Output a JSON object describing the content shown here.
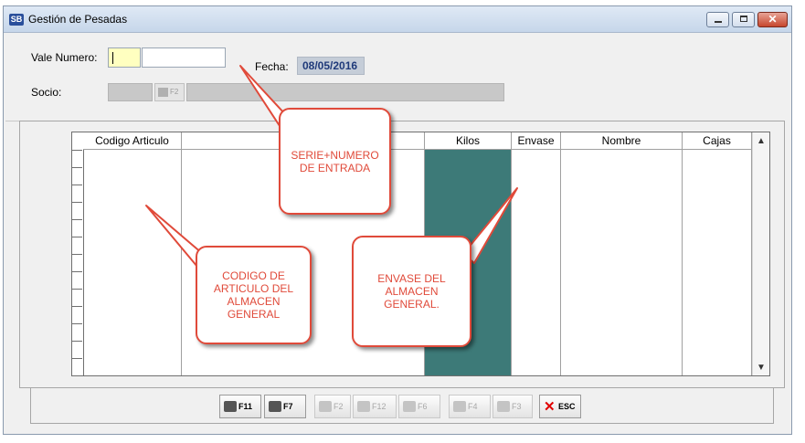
{
  "window": {
    "app_icon_text": "SB",
    "title": "Gestión de Pesadas",
    "controls": {
      "minimize": "minimize",
      "maximize": "maximize",
      "close": "✕"
    }
  },
  "form": {
    "vale_label": "Vale Numero:",
    "vale_value": "",
    "fecha_label": "Fecha:",
    "fecha_value": "08/05/2016",
    "socio_label": "Socio:",
    "socio_button_label": "F2"
  },
  "grid": {
    "columns": [
      "Codigo Articulo",
      "",
      "Kilos",
      "Envase",
      "Nombre",
      "Cajas"
    ],
    "kilos_column_color": "#3d7a78"
  },
  "toolbar": {
    "buttons": [
      {
        "label": "F11",
        "icon": "printer-icon",
        "enabled": true
      },
      {
        "label": "F7",
        "icon": "search-icon",
        "enabled": true
      },
      {
        "label": "F2",
        "icon": "new-document-icon",
        "enabled": false
      },
      {
        "label": "F12",
        "icon": "edit-icon",
        "enabled": false
      },
      {
        "label": "F6",
        "icon": "delete-icon",
        "enabled": false
      },
      {
        "label": "F4",
        "icon": "undo-icon",
        "enabled": false
      },
      {
        "label": "F3",
        "icon": "save-icon",
        "enabled": false
      },
      {
        "label": "ESC",
        "icon": "close-icon",
        "enabled": true
      }
    ]
  },
  "annotations": [
    {
      "text": "SERIE+NUMERO\nDE ENTRADA"
    },
    {
      "text": "CODIGO DE\nARTICULO DEL\nALMACEN\nGENERAL"
    },
    {
      "text": "ENVASE DEL\nALMACEN\nGENERAL."
    }
  ],
  "colors": {
    "annotation": "#e04a3a",
    "fecha_text": "#1f3a7a",
    "vale_input_bg": "#ffffc0"
  }
}
